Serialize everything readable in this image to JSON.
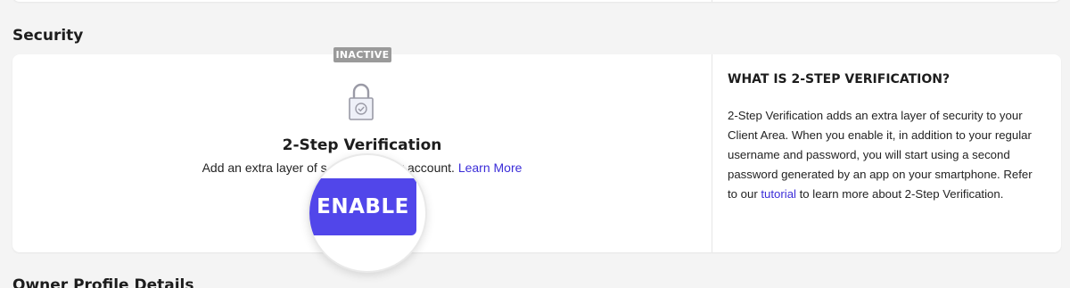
{
  "sections": {
    "security_title": "Security",
    "next_title": "Owner Profile Details"
  },
  "two_step": {
    "status_badge": "INACTIVE",
    "lock_icon": "padlock-check-icon",
    "title": "2-Step Verification",
    "desc_part1": "Add an extra layer of s",
    "desc_part2": "ur account.",
    "learn_more": "Learn More",
    "enable_label": "ENABLE"
  },
  "info": {
    "title": "WHAT IS 2-STEP VERIFICATION?",
    "text_before_link": "2-Step Verification adds an extra layer of security to your Client Area. When you enable it, in addition to your regular username and password, you will start using a second password generated by an app on your smartphone. Refer to our ",
    "link": "tutorial",
    "text_after_link": " to learn more about 2-Step Verification."
  },
  "colors": {
    "accent": "#5146ea",
    "link": "#3b2dd8",
    "badge": "#9a9a9a",
    "background": "#f4f4f4"
  }
}
